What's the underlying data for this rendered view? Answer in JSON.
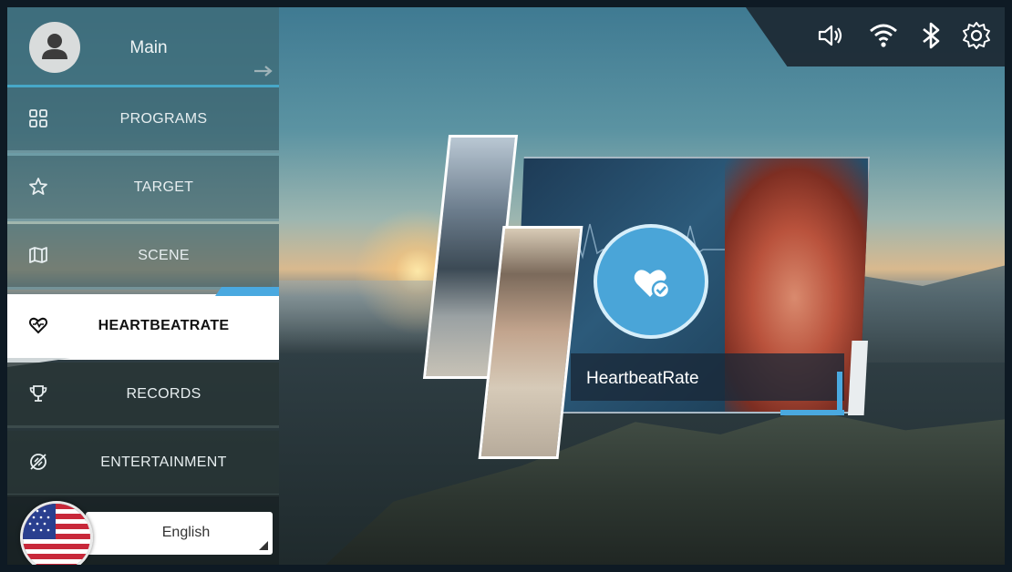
{
  "sidebar": {
    "header": {
      "label": "Main"
    },
    "items": [
      {
        "label": "PROGRAMS",
        "icon": "grid-icon"
      },
      {
        "label": "TARGET",
        "icon": "star-icon"
      },
      {
        "label": "SCENE",
        "icon": "map-icon"
      },
      {
        "label": "HEARTBEATRATE",
        "icon": "heart-icon",
        "active": true
      },
      {
        "label": "RECORDS",
        "icon": "trophy-icon"
      },
      {
        "label": "ENTERTAINMENT",
        "icon": "entertainment-icon"
      }
    ]
  },
  "language": {
    "value": "English",
    "flag": "us-flag"
  },
  "statusbar": {
    "icons": [
      "volume-icon",
      "wifi-icon",
      "bluetooth-icon",
      "settings-icon"
    ]
  },
  "feature": {
    "title": "HeartbeatRate"
  },
  "colors": {
    "accent": "#4aa9e0",
    "active_bg": "#ffffff",
    "menu_bg": "#375a64"
  }
}
